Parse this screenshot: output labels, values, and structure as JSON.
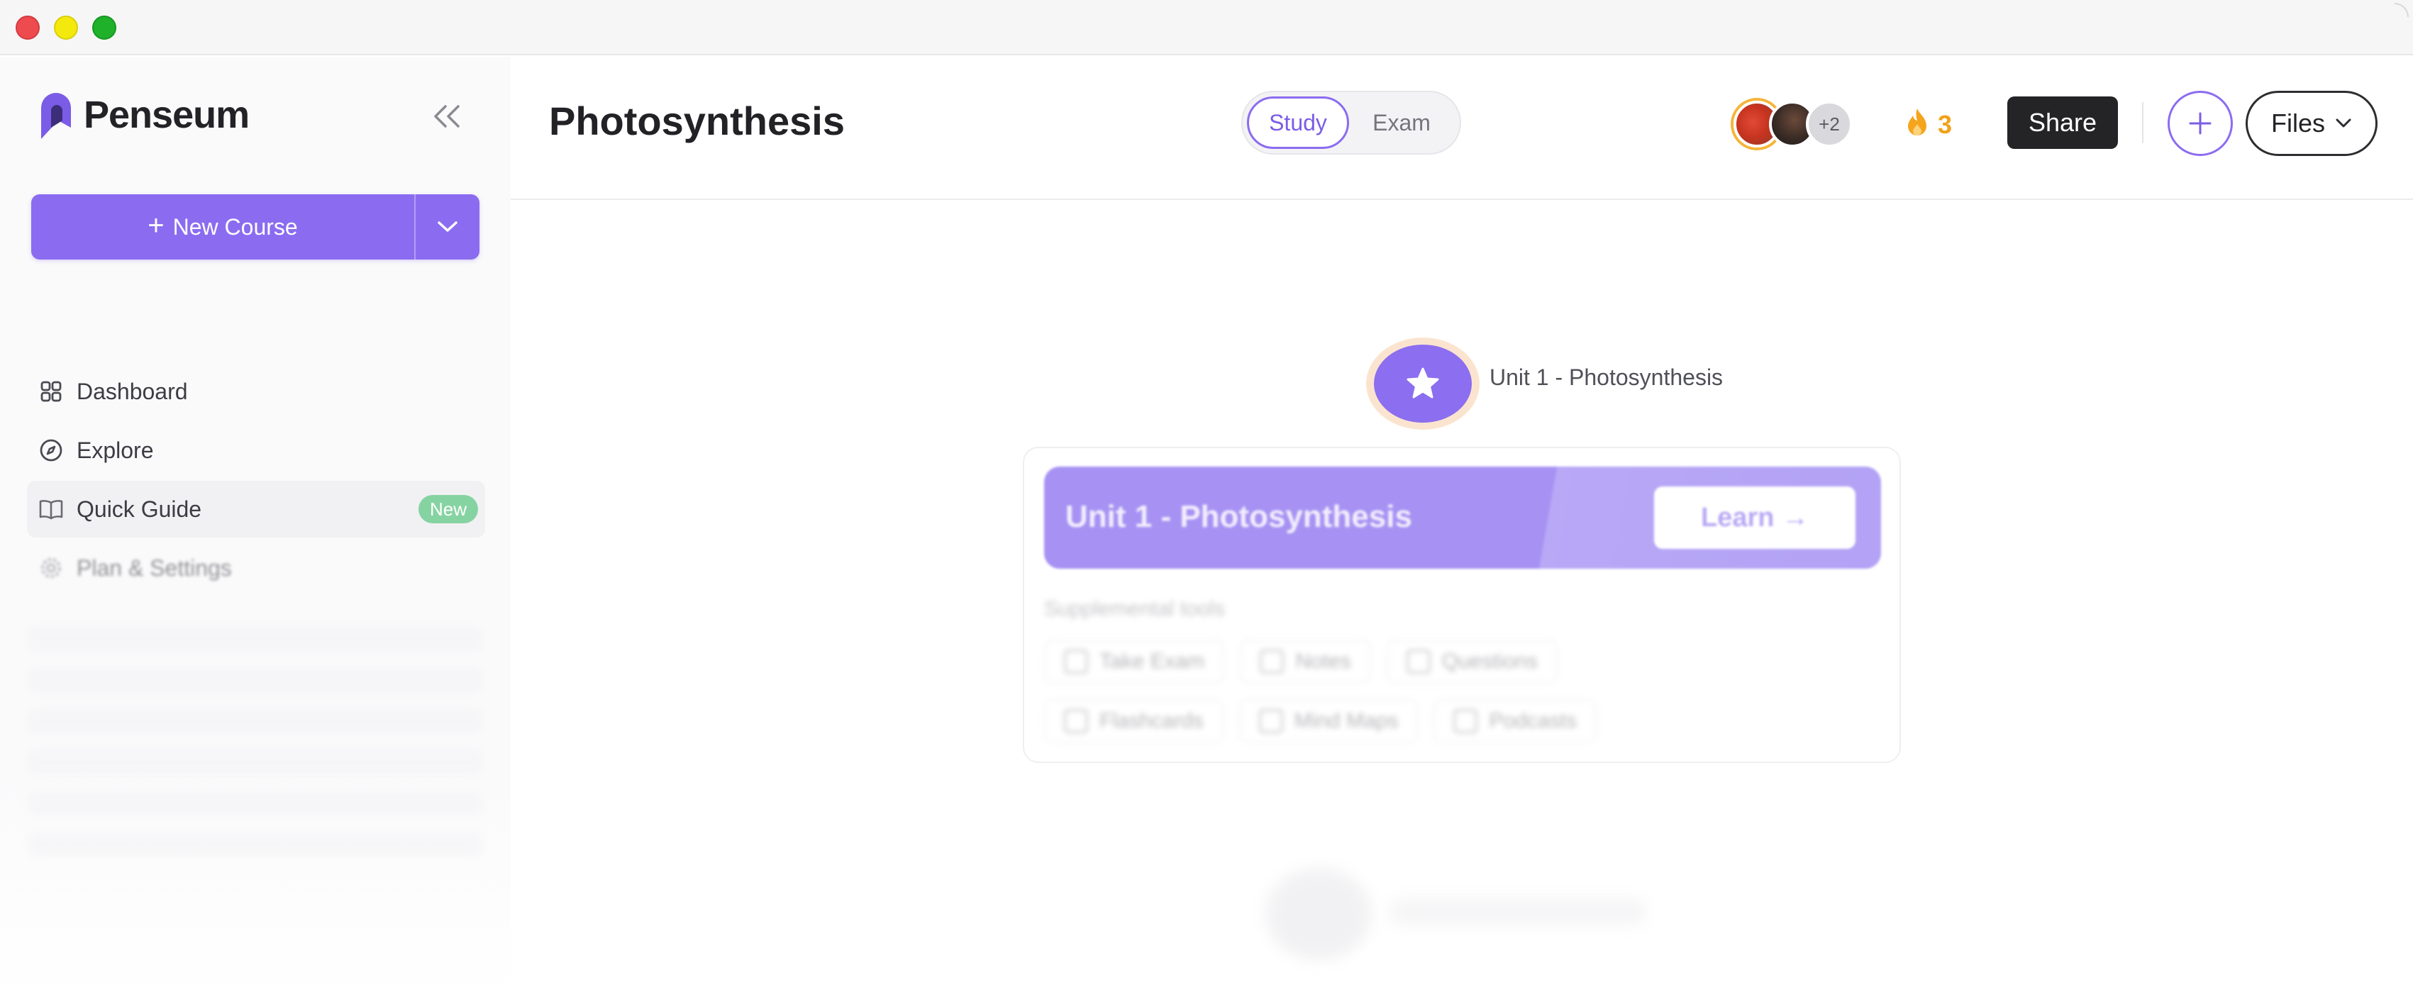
{
  "brand": {
    "name": "Penseum"
  },
  "sidebar": {
    "new_course_label": "New Course",
    "items": [
      {
        "label": "Dashboard",
        "icon": "grid-icon"
      },
      {
        "label": "Explore",
        "icon": "compass-icon"
      },
      {
        "label": "Quick Guide",
        "icon": "book-icon",
        "badge": "New"
      },
      {
        "label": "Plan & Settings",
        "icon": "gear-icon"
      }
    ]
  },
  "header": {
    "title": "Photosynthesis",
    "modes": [
      "Study",
      "Exam"
    ],
    "selected_mode": "Study",
    "avatar_more": "+2",
    "streak_count": "3",
    "share_label": "Share",
    "files_label": "Files"
  },
  "main": {
    "unit_node_label": "Unit 1 - Photosynthesis",
    "unit_card": {
      "title": "Unit 1 - Photosynthesis",
      "learn_label": "Learn →",
      "supplemental_label": "Supplemental tools",
      "tools": [
        [
          "Take Exam",
          "Notes",
          "Questions"
        ],
        [
          "Flashcards",
          "Mind Maps",
          "Podcasts"
        ]
      ]
    }
  },
  "colors": {
    "accent": "#8b6cf0",
    "streak": "#f0a21b",
    "badge_new": "#86d3a2",
    "share_bg": "#242426"
  }
}
